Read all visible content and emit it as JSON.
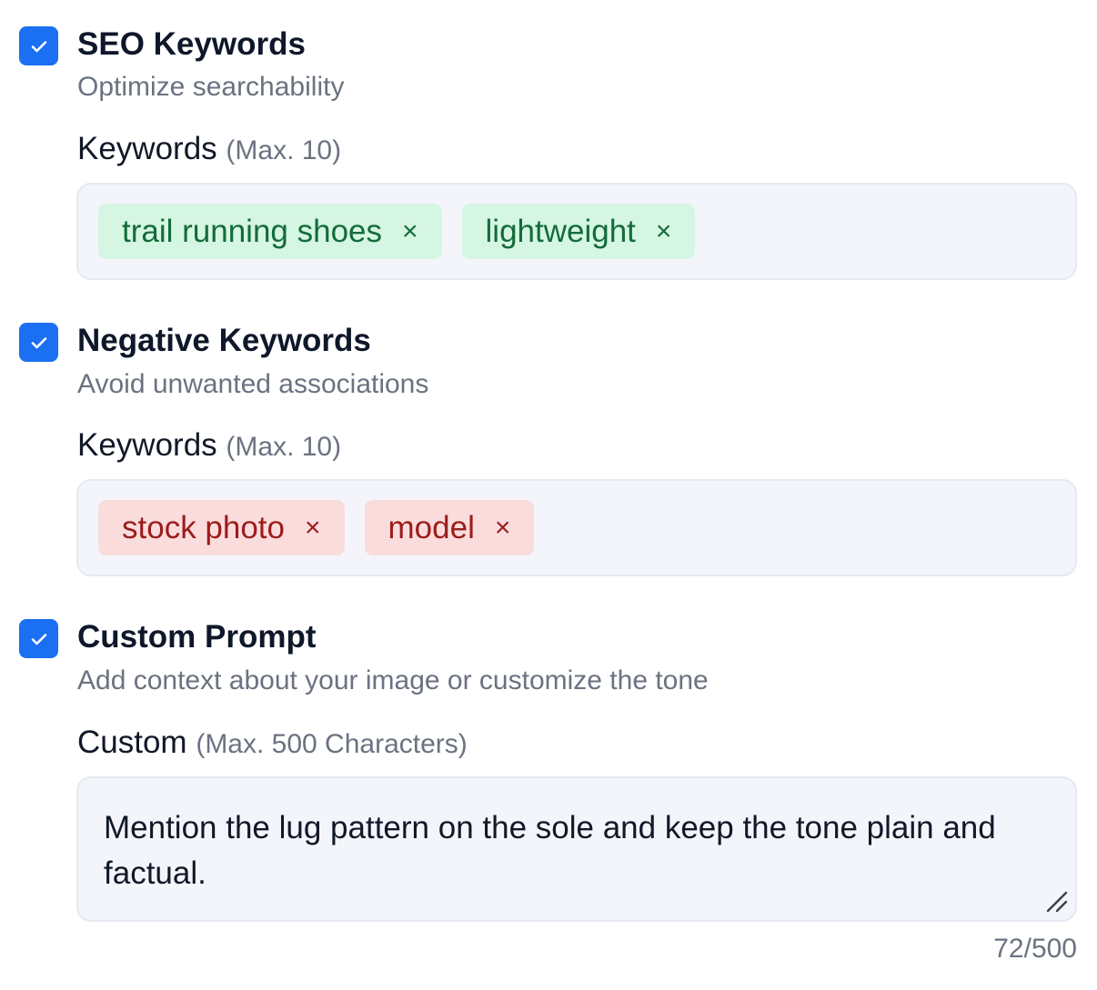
{
  "seo": {
    "title": "SEO Keywords",
    "subtitle": "Optimize searchability",
    "field_label": "Keywords",
    "field_hint": "(Max. 10)",
    "tags": [
      "trail running shoes",
      "lightweight"
    ],
    "remove_glyph": "×",
    "tag_color": "#d5f6e2",
    "checked": true
  },
  "negative": {
    "title": "Negative Keywords",
    "subtitle": "Avoid unwanted associations",
    "field_label": "Keywords",
    "field_hint": "(Max. 10)",
    "tags": [
      "stock photo",
      "model"
    ],
    "remove_glyph": "×",
    "tag_color": "#fbdcdc",
    "checked": true
  },
  "custom": {
    "title": "Custom Prompt",
    "subtitle": "Add context about your image or customize the tone",
    "field_label": "Custom",
    "field_hint": "(Max. 500 Characters)",
    "value": "Mention the lug pattern on the sole and keep the tone plain and factual.",
    "counter": "72/500",
    "checked": true
  },
  "colors": {
    "accent": "#1a6ff2",
    "field_bg": "#f3f5fb",
    "muted_text": "#6b7280"
  },
  "icons": {
    "checkbox": "check-icon",
    "remove": "close-icon",
    "resize": "resize-handle-icon"
  }
}
